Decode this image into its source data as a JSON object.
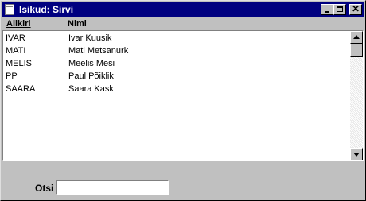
{
  "window": {
    "title": "Isikud: Sirvi",
    "controls": {
      "minimize_icon": "minimize-icon",
      "maximize_icon": "maximize-icon",
      "close_glyph": "✕"
    }
  },
  "list": {
    "columns": {
      "signature": "Allkiri",
      "name": "Nimi"
    },
    "rows": [
      {
        "signature": "IVAR",
        "name": "Ivar Kuusik"
      },
      {
        "signature": "MATI",
        "name": "Mati Metsanurk"
      },
      {
        "signature": "MELIS",
        "name": "Meelis Mesi"
      },
      {
        "signature": "PP",
        "name": "Paul Põiklik"
      },
      {
        "signature": "SAARA",
        "name": "Saara Kask"
      }
    ]
  },
  "search": {
    "label": "Otsi",
    "value": ""
  }
}
